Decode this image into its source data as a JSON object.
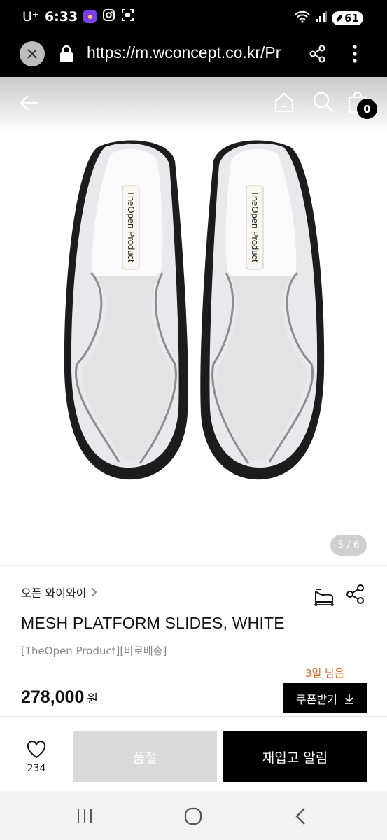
{
  "status_bar": {
    "carrier": "U⁺",
    "time": "6:33",
    "battery": "61",
    "icons": [
      "notification-app-icon",
      "instagram-icon",
      "screenshot-icon",
      "wifi-icon",
      "signal-icon"
    ]
  },
  "browser": {
    "url": "https://m.wconcept.co.kr/Pr",
    "icons": [
      "close-icon",
      "lock-icon",
      "share-icon",
      "more-vert-icon"
    ]
  },
  "header": {
    "bag_count": "0",
    "icons": [
      "back-arrow-icon",
      "home-icon",
      "search-icon",
      "shopping-bag-icon"
    ]
  },
  "gallery": {
    "pager": "5 / 6",
    "shoe_label": "TheOpen Product"
  },
  "product": {
    "brand_link": "오픈 와이와이",
    "title": "MESH PLATFORM SLIDES, WHITE",
    "subtitle": "[TheOpen Product][바로배송]",
    "coupon_days_left": "3일 남음",
    "price": "278,000",
    "price_unit": "원",
    "coupon_button": "쿠폰받기"
  },
  "actions": {
    "like_count": "234",
    "soldout_label": "품절",
    "restock_label": "재입고 알림"
  },
  "colors": {
    "status_bar_bg": "#000000",
    "coupon_days_text": "#d36b2c",
    "primary_button_bg": "#000000",
    "disabled_button_bg": "#d9d9d9"
  }
}
